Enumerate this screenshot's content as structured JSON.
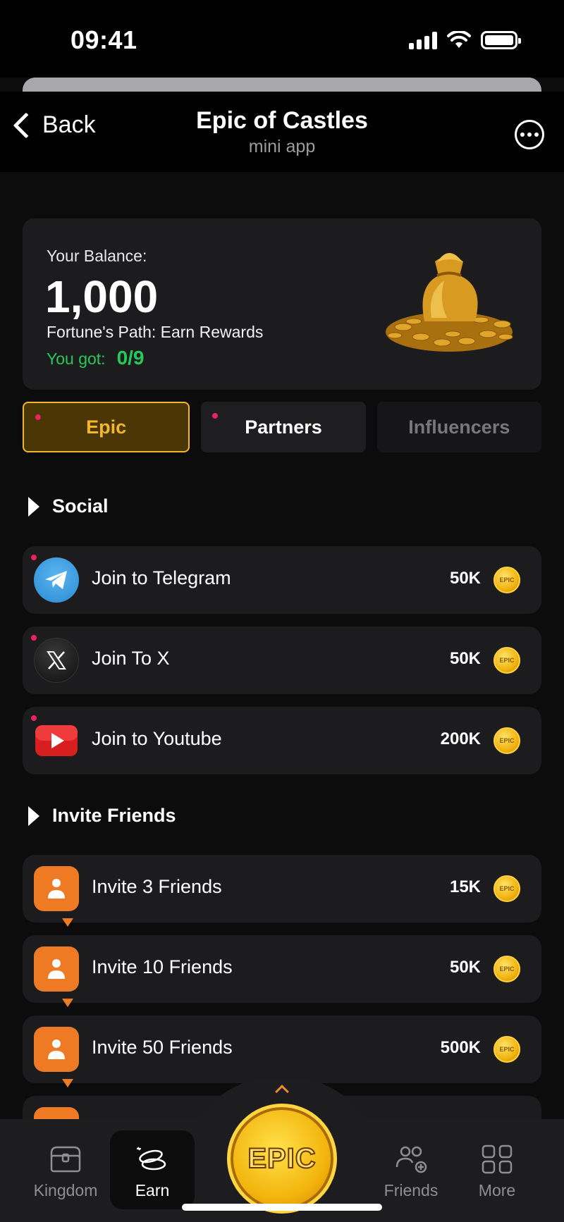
{
  "status": {
    "time": "09:41"
  },
  "header": {
    "back": "Back",
    "title": "Epic of Castles",
    "subtitle": "mini app"
  },
  "balance": {
    "label": "Your Balance:",
    "value": "1,000",
    "path_label": "Fortune's Path: Earn Rewards",
    "got_label": "You got:",
    "got_value": "0/9"
  },
  "tabs": [
    {
      "label": "Epic",
      "active": true,
      "dot": true
    },
    {
      "label": "Partners",
      "active": false,
      "dot": true
    },
    {
      "label": "Influencers",
      "active": false,
      "dot": false
    }
  ],
  "sections": {
    "social": {
      "title": "Social",
      "tasks": [
        {
          "label": "Join to Telegram",
          "reward": "50K",
          "icon": "telegram-icon"
        },
        {
          "label": "Join To X",
          "reward": "50K",
          "icon": "x-icon"
        },
        {
          "label": "Join to Youtube",
          "reward": "200K",
          "icon": "youtube-icon"
        }
      ]
    },
    "invite": {
      "title": "Invite Friends",
      "tasks": [
        {
          "label": "Invite 3 Friends",
          "reward": "15K",
          "icon": "invite-icon"
        },
        {
          "label": "Invite 10 Friends",
          "reward": "50K",
          "icon": "invite-icon"
        },
        {
          "label": "Invite 50 Friends",
          "reward": "500K",
          "icon": "invite-icon"
        }
      ]
    }
  },
  "coin_label": "EPIC",
  "nav": {
    "kingdom": "Kingdom",
    "earn": "Earn",
    "center": "EPIC",
    "friends": "Friends",
    "more": "More"
  },
  "colors": {
    "accent": "#f4b62c",
    "success": "#27c85a",
    "notify_dot": "#e8245e",
    "background": "#0c0c0d",
    "card": "#1c1c1f"
  }
}
